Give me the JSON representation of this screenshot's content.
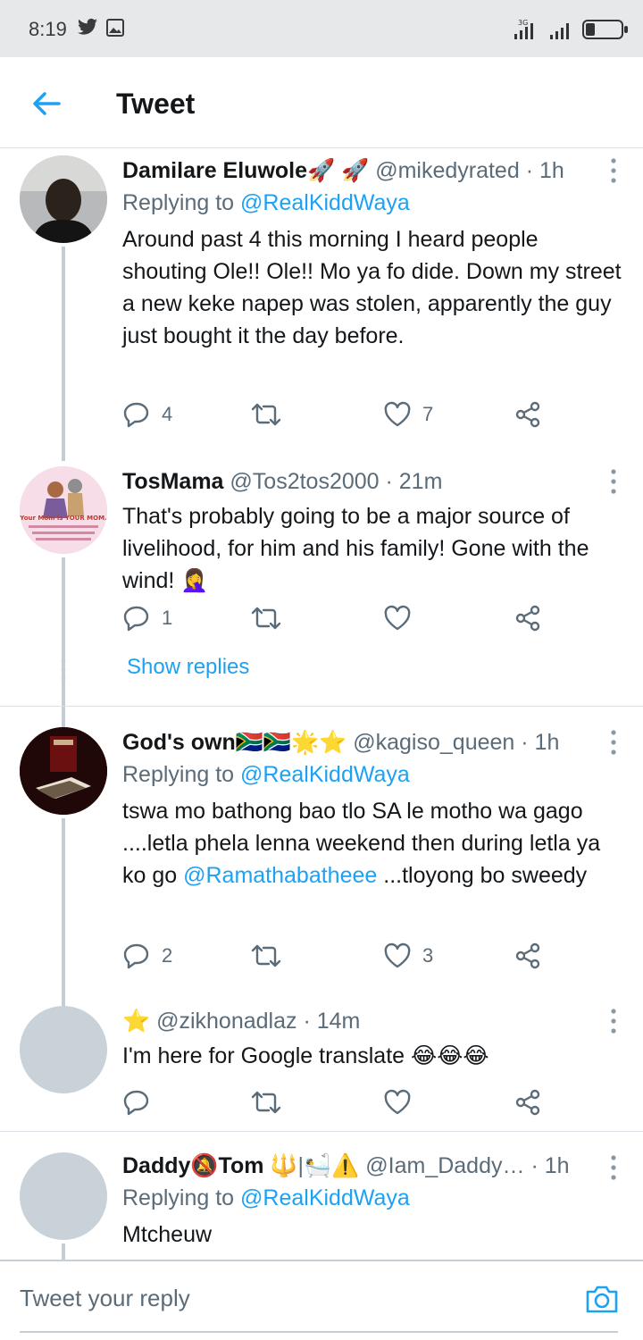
{
  "status_bar": {
    "time": "8:19",
    "network": "3G"
  },
  "header": {
    "title": "Tweet"
  },
  "tweets": [
    {
      "name": "Damilare Eluwole",
      "name_emoji": "🚀 🚀",
      "handle": "@mikedyrated",
      "time": "1h",
      "replying_prefix": "Replying to",
      "replying_to": "@RealKiddWaya",
      "text": "Around past 4 this morning I heard people shouting  Ole!! Ole!!  Mo ya fo dide. Down my street a new keke napep was stolen, apparently the guy just bought it the day before.",
      "replies": "4",
      "retweets": "",
      "likes": "7"
    },
    {
      "name": "TosMama",
      "name_emoji": "",
      "handle": "@Tos2tos2000",
      "time": "21m",
      "text": "That's probably going to be a major source of livelihood, for him and his family! Gone with the wind! 🤦‍♀️",
      "avatar_text": "Your Mom is YOUR MOM.",
      "replies": "1",
      "retweets": "",
      "likes": ""
    },
    {
      "name": "God's own",
      "name_emoji": "🇿🇦🇿🇦🌟⭐",
      "handle": "@kagiso_queen",
      "time": "1h",
      "replying_prefix": "Replying to",
      "replying_to": "@RealKiddWaya",
      "text_before": "tswa mo bathong bao tlo SA le motho wa gago ....letla phela lenna weekend then during letla ya ko go ",
      "text_mention": "@Ramathabatheee",
      "text_after": " ...tloyong bo sweedy",
      "replies": "2",
      "retweets": "",
      "likes": "3"
    },
    {
      "name": "",
      "name_emoji": "⭐",
      "handle": "@zikhonadlaz",
      "time": "14m",
      "text": "I'm here for Google translate 😂😂😂",
      "replies": "",
      "retweets": "",
      "likes": ""
    },
    {
      "name": "Daddy",
      "name_mid_emoji": "🔕",
      "name2": "Tom",
      "name_emoji": "🔱|🛀⚠️",
      "handle": "@Iam_Daddy…",
      "time": "1h",
      "replying_prefix": "Replying to",
      "replying_to": "@RealKiddWaya",
      "text": "Mtcheuw"
    }
  ],
  "show_replies": "Show replies",
  "reply_bar": {
    "placeholder": "Tweet your reply"
  },
  "colors": {
    "accent": "#1da1f2",
    "text": "#14171a",
    "muted": "#5b6b78",
    "divider": "#dbe1e6"
  }
}
